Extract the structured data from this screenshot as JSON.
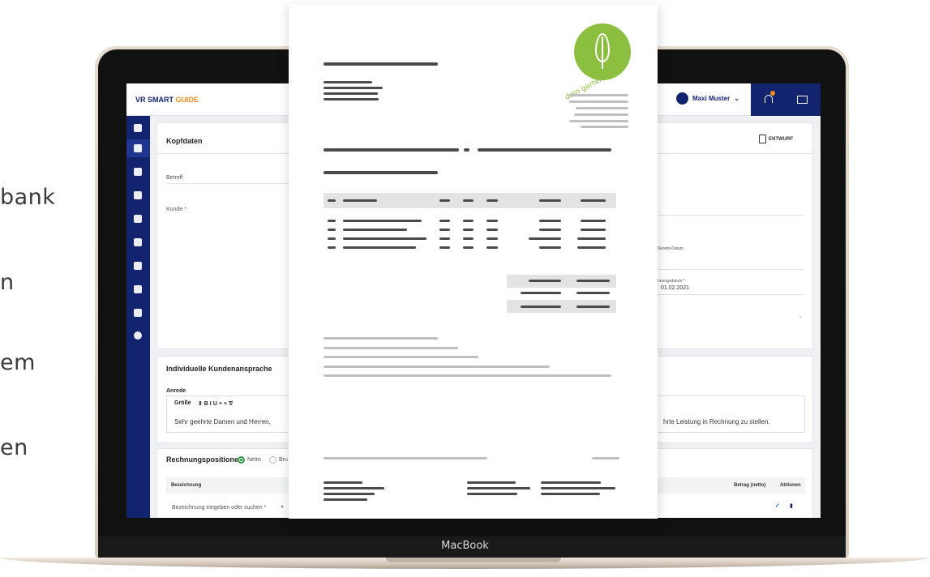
{
  "side_text": [
    "bank",
    "n",
    "em",
    "en"
  ],
  "device": {
    "brand": "MacBook"
  },
  "app": {
    "logo_main": "VR SMART ",
    "logo_accent": "GUIDE",
    "user_name": "Maxi Muster",
    "notification_count": "1"
  },
  "kopfdaten": {
    "title": "Kopfdaten",
    "status_label": "ENTWURF",
    "betreff_label": "Betreff",
    "kunde_label": "Kunde *",
    "skonto_label": "Skonto-Datum",
    "rechnungsdatum_label": "hnungsdatum *",
    "rechnungsdatum_value": "01.02.2021"
  },
  "anrede_card": {
    "title": "Individuelle Kundenansprache",
    "anrede_label": "Anrede",
    "toolbar_size": "Größe",
    "toolbar_icons": "⇕ B I U ≡ ≡ T̸",
    "greeting": "Sehr geehrte Damen und Herren,",
    "closing_fragment": "hrte Leistung in Rechnung zu stellen."
  },
  "positionen": {
    "title": "Rechnungspositionen",
    "netto": "Netto",
    "brutto": "Bru",
    "col_bezeichnung": "Bezeichnung",
    "col_betrag": "Betrag (netto)",
    "col_aktionen": "Aktionen",
    "row_placeholder": "Bezeichnung eingeben oder suchen *"
  },
  "invoice_logo": {
    "text": "dein gartenbau.de"
  },
  "colors": {
    "navy": "#13246e",
    "orange": "#f28c1e",
    "green": "#8cbf3f",
    "radio_green": "#2e9a44"
  }
}
